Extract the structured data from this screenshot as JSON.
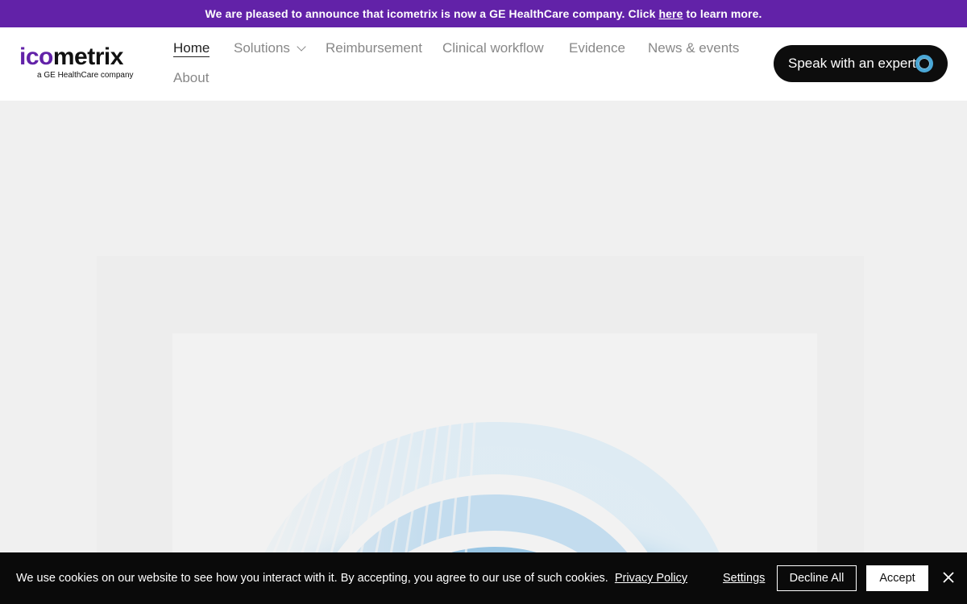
{
  "announcement": {
    "prefix": "We are pleased to announce that icometrix is now a GE HealthCare company. Click",
    "link": "here",
    "suffix": "to learn more.",
    "background": "#6222a8"
  },
  "logo": {
    "part1": "ico",
    "part2": "metrix",
    "tagline": "a GE HealthCare company",
    "accent": "#6222a8"
  },
  "nav": {
    "items": [
      {
        "label": "Home",
        "active": true
      },
      {
        "label": "Solutions",
        "has_dropdown": true,
        "icon": "chevron-down-icon"
      },
      {
        "label": "Reimbursement"
      },
      {
        "label": "Clinical workflow"
      },
      {
        "label": "Evidence"
      },
      {
        "label": "News & events"
      },
      {
        "label": "About"
      }
    ]
  },
  "cta": {
    "label": "Speak with an expert",
    "icon": "ring-logo-icon",
    "background": "#0d0d0d"
  },
  "cookie": {
    "message": "We use cookies on our website to see how you interact with it. By accepting, you agree to our use of such cookies.",
    "privacy_link": "Privacy Policy",
    "settings": "Settings",
    "decline": "Decline All",
    "accept": "Accept",
    "close_icon": "close-icon"
  }
}
